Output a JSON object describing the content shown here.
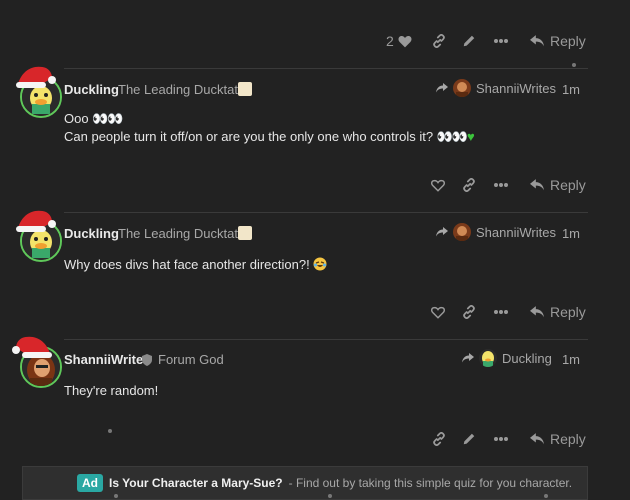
{
  "top_actions": {
    "like_count": "2",
    "reply_label": "Reply"
  },
  "posts": [
    {
      "username": "Duckling",
      "user_title": "The Leading Ducktator",
      "reply_to": "ShanniiWrites",
      "time": "1m",
      "body_line1": "Ooo",
      "body_line2": "Can people turn it off/on or are you the only one who controls it?",
      "eyes1": "👀👀",
      "eyes2": "👀👀",
      "reply_label": "Reply"
    },
    {
      "username": "Duckling",
      "user_title": "The Leading Ducktator",
      "reply_to": "ShanniiWrites",
      "time": "1m",
      "body_line1": "Why does divs hat face another direction?!",
      "reply_label": "Reply"
    },
    {
      "username": "ShanniiWrites",
      "user_title": "Forum God",
      "reply_to": "Duckling",
      "time": "1m",
      "body_line1": "They're random!",
      "reply_label": "Reply"
    }
  ],
  "ad": {
    "badge": "Ad",
    "title": "Is Your Character a Mary-Sue?",
    "text": "- Find out by taking this simple quiz for you character."
  },
  "colors": {
    "background": "#222222",
    "avatar_ring": "#5fc85a",
    "ad_badge": "#2aa8a3"
  },
  "icons": [
    "heart-icon",
    "link-icon",
    "pencil-icon",
    "more-icon",
    "reply-icon",
    "share-arrow-icon",
    "santa-hat-icon",
    "shield-icon"
  ]
}
